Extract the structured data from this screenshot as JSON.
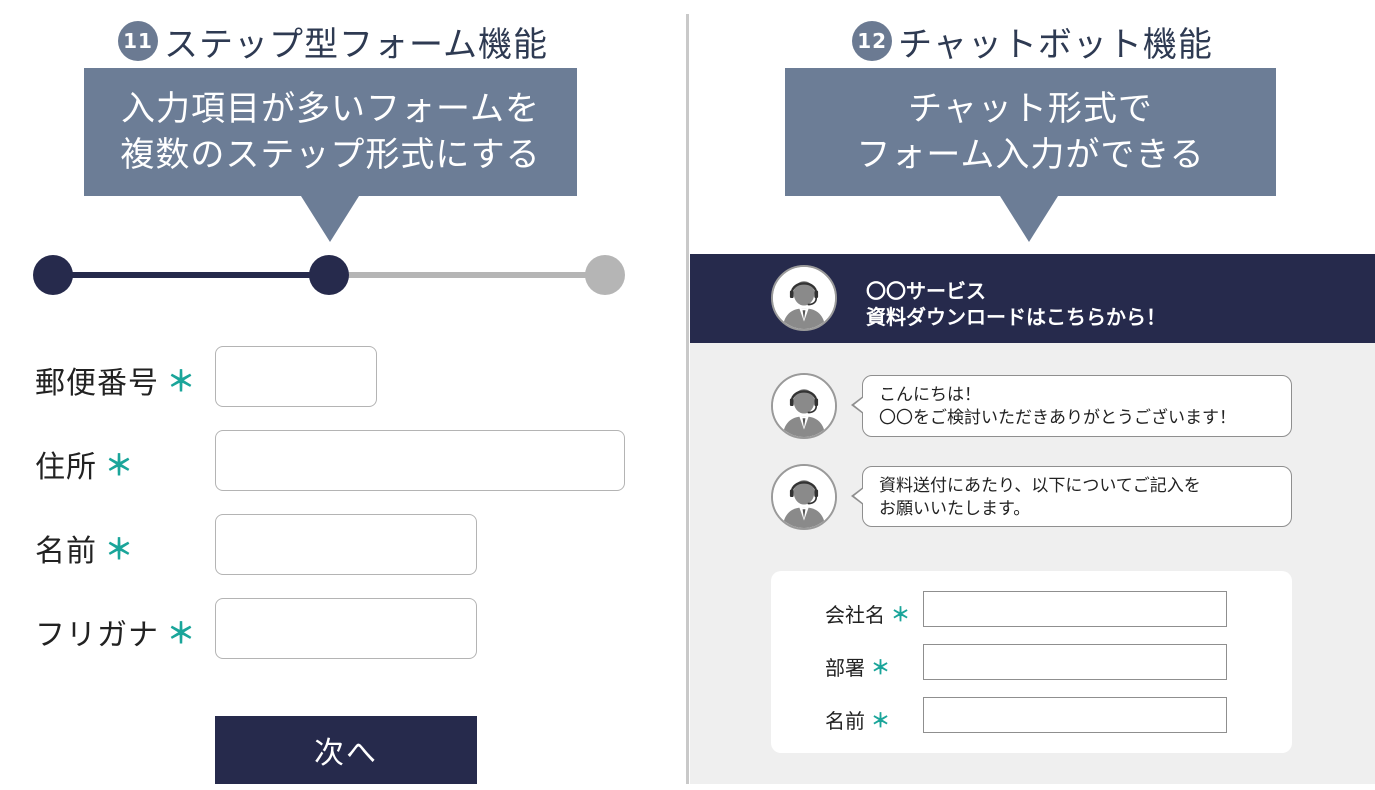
{
  "left": {
    "badge": "11",
    "heading": "ステップ型フォーム機能",
    "callout": [
      "入力項目が多いフォームを",
      "複数のステップ形式にする"
    ],
    "stepper": {
      "total_steps": 3,
      "current_step": 2
    },
    "fields": [
      {
        "label": "郵便番号",
        "value": ""
      },
      {
        "label": "住所",
        "value": ""
      },
      {
        "label": "名前",
        "value": ""
      },
      {
        "label": "フリガナ",
        "value": ""
      }
    ],
    "required_mark": "＊",
    "next_label": "次へ"
  },
  "right": {
    "badge": "12",
    "heading": "チャットボット機能",
    "callout": [
      "チャット形式で",
      "フォーム入力ができる"
    ],
    "chat_header": {
      "line1": "〇〇サービス",
      "line2": "資料ダウンロードはこちらから！"
    },
    "messages": [
      {
        "line1": "こんにちは！",
        "line2": "〇〇をご検討いただきありがとうございます！"
      },
      {
        "line1": "資料送付にあたり、以下についてご記入を",
        "line2": "お願いいたします。"
      }
    ],
    "form_fields": [
      {
        "label": "会社名",
        "value": ""
      },
      {
        "label": "部署",
        "value": ""
      },
      {
        "label": "名前",
        "value": ""
      }
    ],
    "required_mark": "＊"
  },
  "colors": {
    "navy": "#262a4c",
    "slate": "#6c7d96",
    "teal": "#1aa59a",
    "gray": "#b5b5b5"
  },
  "icons": {
    "avatar": "headset-operator-icon"
  }
}
